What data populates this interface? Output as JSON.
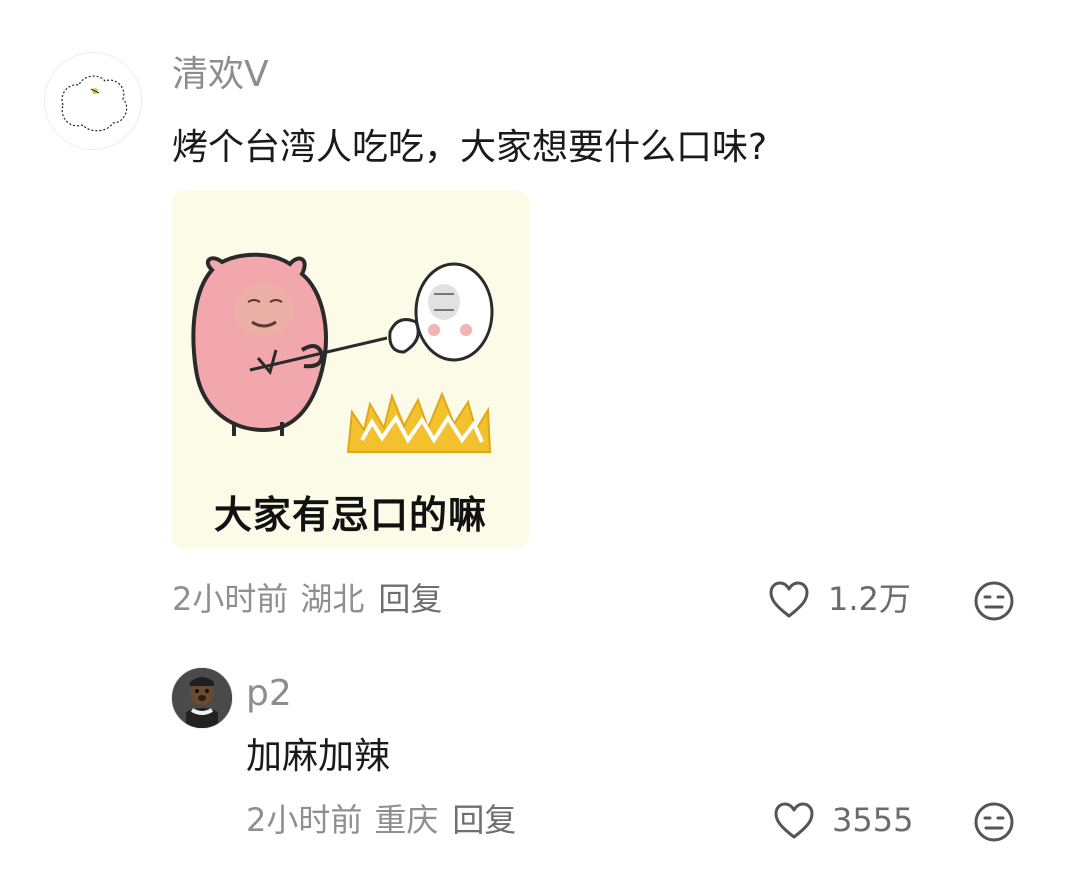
{
  "comment": {
    "username": "清欢V",
    "text": "烤个台湾人吃吃，大家想要什么口味?",
    "image_caption": "大家有忌口的嘛",
    "time": "2小时前",
    "location": "湖北",
    "reply_label": "回复",
    "like_count": "1.2万"
  },
  "reply": {
    "username": "p2",
    "text": "加麻加辣",
    "time": "2小时前",
    "location": "重庆",
    "reply_label": "回复",
    "like_count": "3555"
  },
  "icons": {
    "like": "heart-outline-icon",
    "dislike": "meh-face-icon"
  },
  "colors": {
    "meme_background": "#fcfbe8",
    "pig_pink": "#f2a7ad",
    "fire_yellow": "#f3c02e"
  }
}
